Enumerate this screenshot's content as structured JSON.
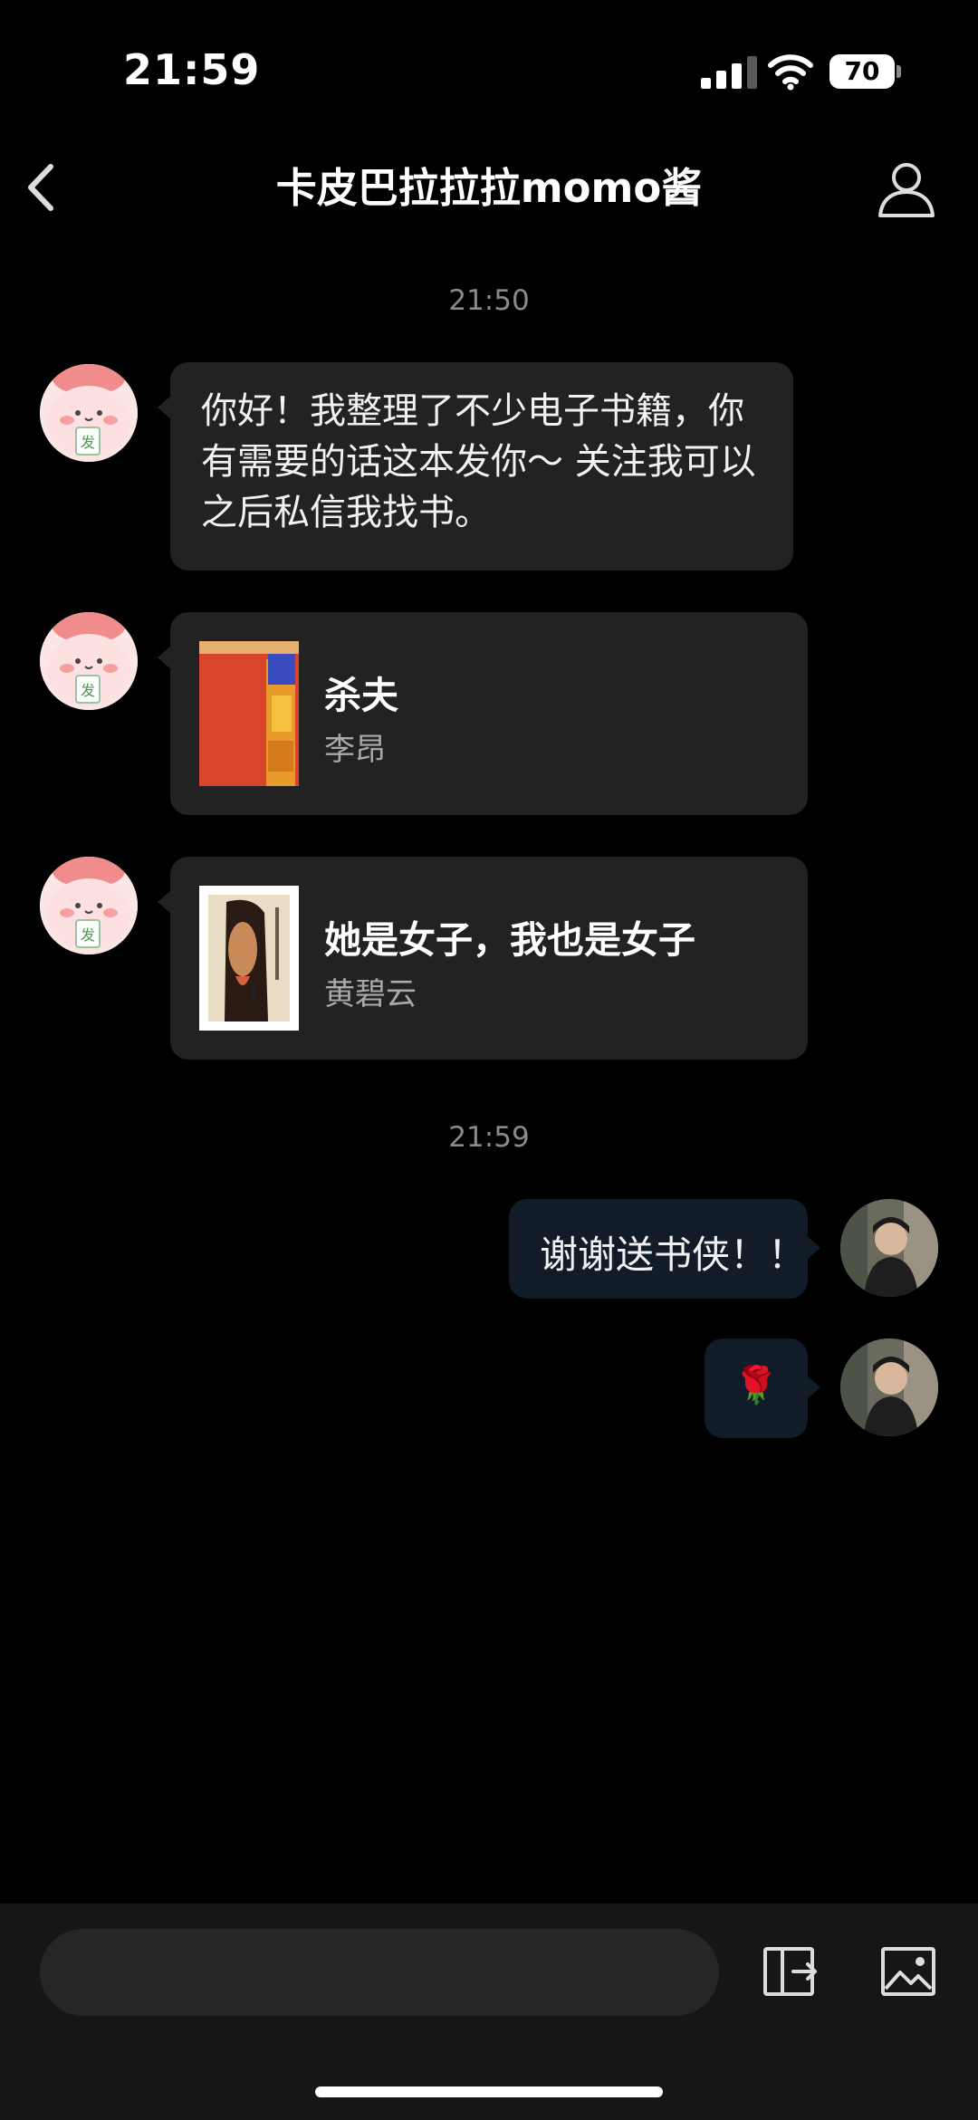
{
  "status_bar": {
    "time": "21:59",
    "battery": "70"
  },
  "header": {
    "title": "卡皮巴拉拉拉momo酱"
  },
  "messages": [
    {
      "type": "timestamp",
      "text": "21:50"
    },
    {
      "type": "text",
      "sender": "other",
      "text": "你好！我整理了不少电子书籍，你有需要的话这本发你～ 关注我可以之后私信我找书。"
    },
    {
      "type": "book",
      "sender": "other",
      "title": "杀夫",
      "author": "李昂"
    },
    {
      "type": "book",
      "sender": "other",
      "title": "她是女子，我也是女子",
      "author": "黄碧云"
    },
    {
      "type": "timestamp",
      "text": "21:59"
    },
    {
      "type": "text",
      "sender": "me",
      "text": "谢谢送书侠！！"
    },
    {
      "type": "emoji",
      "sender": "me",
      "text": "🌹"
    }
  ],
  "colors": {
    "incoming_bubble": "#222222",
    "outgoing_bubble": "#121c28",
    "background": "#000000"
  }
}
